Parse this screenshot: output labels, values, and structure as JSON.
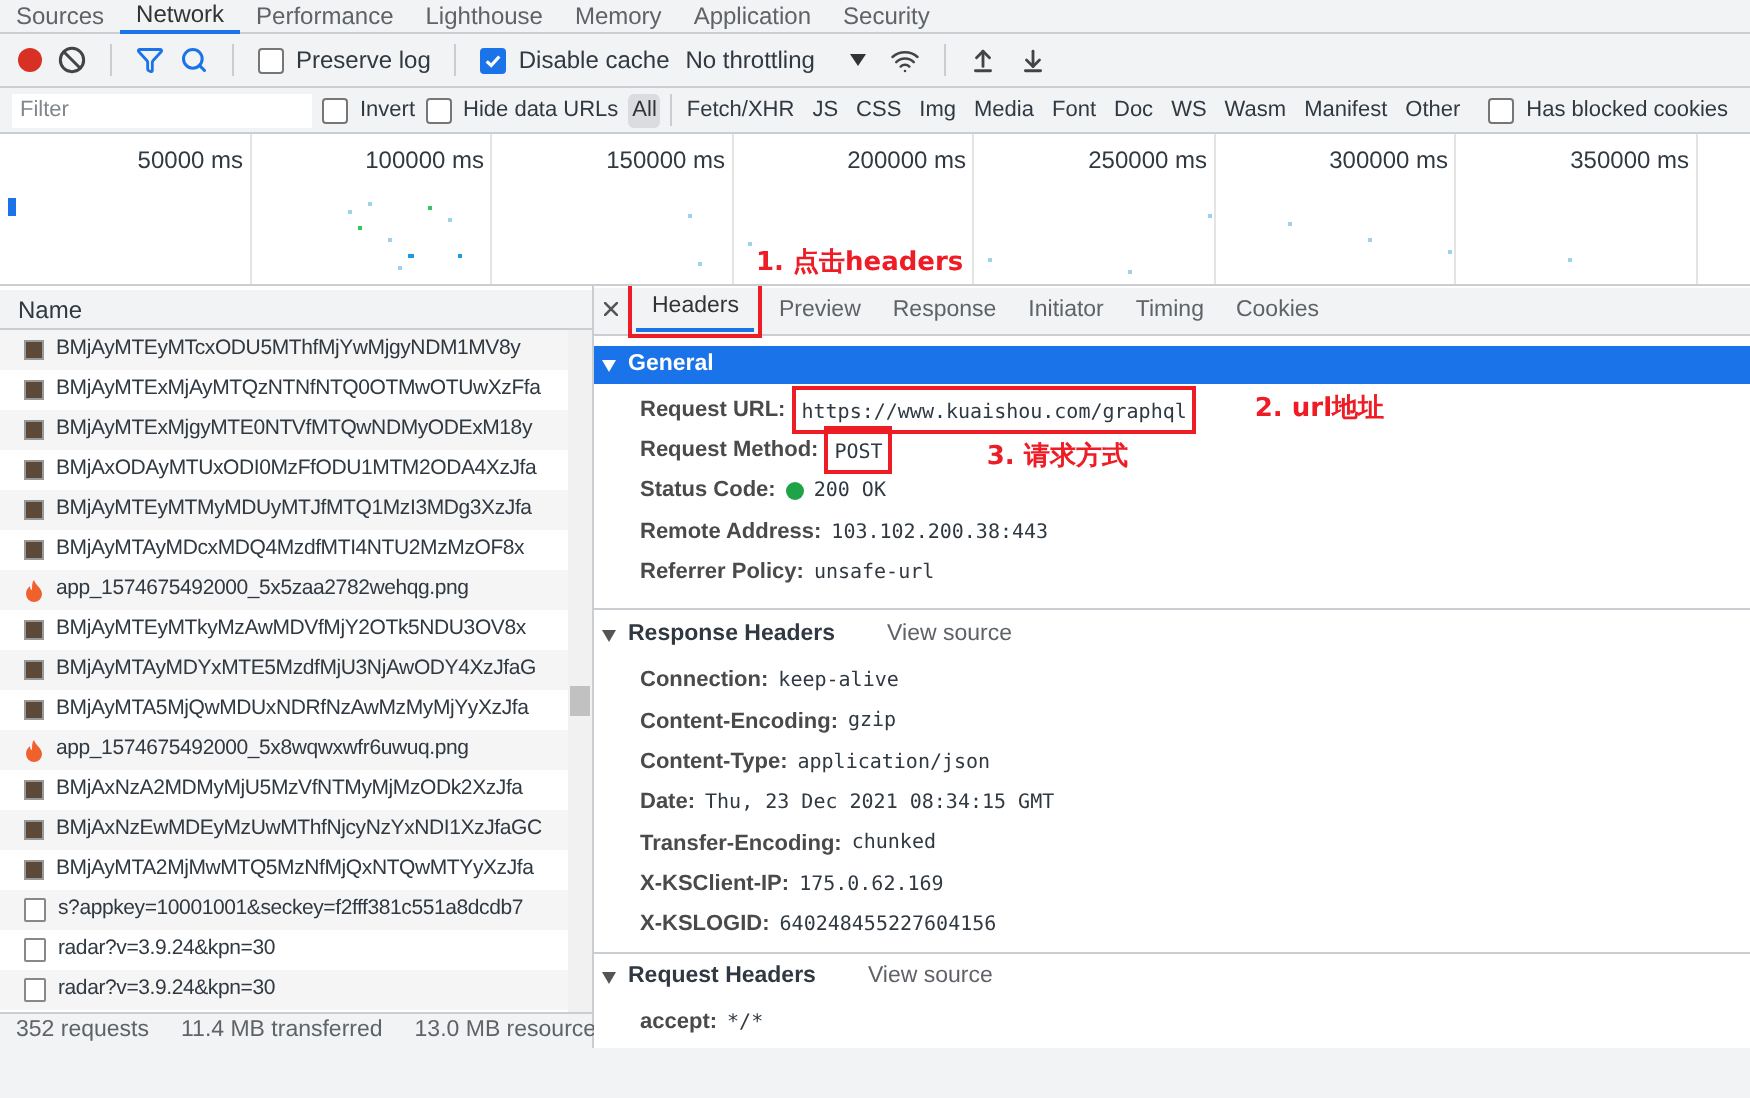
{
  "panel_tabs": [
    {
      "label": "Sources",
      "selected": false
    },
    {
      "label": "Network",
      "selected": true
    },
    {
      "label": "Performance",
      "selected": false
    },
    {
      "label": "Lighthouse",
      "selected": false
    },
    {
      "label": "Memory",
      "selected": false
    },
    {
      "label": "Application",
      "selected": false
    },
    {
      "label": "Security",
      "selected": false
    }
  ],
  "toolbar": {
    "recording": true,
    "preserve_log": {
      "label": "Preserve log",
      "checked": false
    },
    "disable_cache": {
      "label": "Disable cache",
      "checked": true
    },
    "throttling": "No throttling"
  },
  "filter_bar": {
    "placeholder": "Filter",
    "invert": {
      "label": "Invert",
      "checked": false
    },
    "hide_data_urls": {
      "label": "Hide data URLs",
      "checked": false
    },
    "types": [
      {
        "label": "All",
        "selected": true
      },
      {
        "label": "Fetch/XHR",
        "selected": false
      },
      {
        "label": "JS",
        "selected": false
      },
      {
        "label": "CSS",
        "selected": false
      },
      {
        "label": "Img",
        "selected": false
      },
      {
        "label": "Media",
        "selected": false
      },
      {
        "label": "Font",
        "selected": false
      },
      {
        "label": "Doc",
        "selected": false
      },
      {
        "label": "WS",
        "selected": false
      },
      {
        "label": "Wasm",
        "selected": false
      },
      {
        "label": "Manifest",
        "selected": false
      },
      {
        "label": "Other",
        "selected": false
      }
    ],
    "has_blocked_cookies": {
      "label": "Has blocked cookies",
      "checked": false
    }
  },
  "timeline": {
    "ticks": [
      "50000 ms",
      "100000 ms",
      "150000 ms",
      "200000 ms",
      "250000 ms",
      "300000 ms",
      "350000 ms"
    ]
  },
  "requests": {
    "column": "Name",
    "rows": [
      {
        "kind": "thumbnail",
        "name": "BMjAyMTEyMTcxODU5MThfMjYwMjgyNDM1MV8y"
      },
      {
        "kind": "thumbnail",
        "name": "BMjAyMTExMjAyMTQzNTNfNTQ0OTMwOTUwXzFfa"
      },
      {
        "kind": "thumbnail",
        "name": "BMjAyMTExMjgyMTE0NTVfMTQwNDMyODExM18y"
      },
      {
        "kind": "thumbnail",
        "name": "BMjAxODAyMTUxODI0MzFfODU1MTM2ODA4XzJfa"
      },
      {
        "kind": "thumbnail",
        "name": "BMjAyMTEyMTMyMDUyMTJfMTQ1MzI3MDg3XzJfa"
      },
      {
        "kind": "thumbnail",
        "name": "BMjAyMTAyMDcxMDQ4MzdfMTI4NTU2MzMzOF8x"
      },
      {
        "kind": "png",
        "name": "app_1574675492000_5x5zaa2782wehqg.png"
      },
      {
        "kind": "thumbnail",
        "name": "BMjAyMTEyMTkyMzAwMDVfMjY2OTk5NDU3OV8x"
      },
      {
        "kind": "thumbnail",
        "name": "BMjAyMTAyMDYxMTE5MzdfMjU3NjAwODY4XzJfaG"
      },
      {
        "kind": "thumbnail",
        "name": "BMjAyMTA5MjQwMDUxNDRfNzAwMzMyMjYyXzJfa"
      },
      {
        "kind": "png",
        "name": "app_1574675492000_5x8wqwxwfr6uwuq.png"
      },
      {
        "kind": "thumbnail",
        "name": "BMjAxNzA2MDMyMjU5MzVfNTMyMjMzODk2XzJfa"
      },
      {
        "kind": "thumbnail",
        "name": "BMjAxNzEwMDEyMzUwMThfNjcyNzYxNDI1XzJfaGC"
      },
      {
        "kind": "thumbnail",
        "name": "BMjAyMTA2MjMwMTQ5MzNfMjQxNTQwMTYyXzJfa"
      },
      {
        "kind": "document",
        "name": "s?appkey=10001001&seckey=f2fff381c551a8dcdb7"
      },
      {
        "kind": "document",
        "name": "radar?v=3.9.24&kpn=30"
      },
      {
        "kind": "document",
        "name": "radar?v=3.9.24&kpn=30"
      }
    ]
  },
  "status_bar": [
    "352 requests",
    "11.4 MB transferred",
    "13.0 MB resource"
  ],
  "details": {
    "tabs": [
      {
        "label": "Headers",
        "selected": true
      },
      {
        "label": "Preview",
        "selected": false
      },
      {
        "label": "Response",
        "selected": false
      },
      {
        "label": "Initiator",
        "selected": false
      },
      {
        "label": "Timing",
        "selected": false
      },
      {
        "label": "Cookies",
        "selected": false
      }
    ],
    "sections": [
      {
        "title": "General",
        "highlighted": true,
        "rows": [
          {
            "name": "Request URL:",
            "value": "https://www.kuaishou.com/graphql"
          },
          {
            "name": "Request Method:",
            "value": "POST"
          },
          {
            "name": "Status Code:",
            "value": "200 OK",
            "color": "#1ea446"
          },
          {
            "name": "Remote Address:",
            "value": "103.102.200.38:443"
          },
          {
            "name": "Referrer Policy:",
            "value": "unsafe-url"
          }
        ]
      },
      {
        "title": "Response Headers",
        "highlighted": false,
        "view_source": "View source",
        "rows": [
          {
            "name": "Connection:",
            "value": "keep-alive"
          },
          {
            "name": "Content-Encoding:",
            "value": "gzip"
          },
          {
            "name": "Content-Type:",
            "value": "application/json"
          },
          {
            "name": "Date:",
            "value": "Thu, 23 Dec 2021 08:34:15 GMT"
          },
          {
            "name": "Transfer-Encoding:",
            "value": "chunked"
          },
          {
            "name": "X-KSClient-IP:",
            "value": "175.0.62.169"
          },
          {
            "name": "X-KSLOGID:",
            "value": "640248455227604156"
          }
        ]
      },
      {
        "title": "Request Headers",
        "highlighted": false,
        "view_source": "View source",
        "rows": [
          {
            "name": "accept:",
            "value": "*/*"
          }
        ]
      }
    ]
  },
  "annotations": [
    {
      "label": "1. 点击headers"
    },
    {
      "label": "2. url地址"
    },
    {
      "label": "3. 请求方式"
    }
  ]
}
